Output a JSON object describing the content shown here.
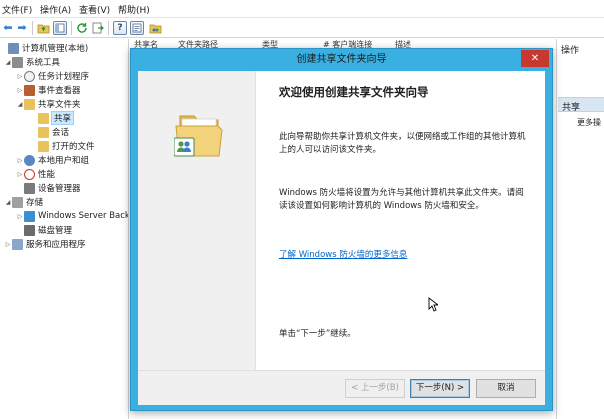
{
  "menubar": {
    "items": [
      "文件(F)",
      "操作(A)",
      "查看(V)",
      "帮助(H)"
    ]
  },
  "toolbar": {
    "icons": [
      "back-arrow-icon",
      "forward-arrow-icon",
      "up-folder-icon",
      "show-tree-icon",
      "refresh-icon",
      "export-list-icon",
      "help-icon",
      "properties-icon",
      "share-folder-icon"
    ]
  },
  "tree": {
    "root": "计算机管理(本地)",
    "system_tools": "系统工具",
    "task_scheduler": "任务计划程序",
    "event_viewer": "事件查看器",
    "shared_folders": "共享文件夹",
    "shares": "共享",
    "sessions": "会话",
    "open_files": "打开的文件",
    "local_users": "本地用户和组",
    "performance": "性能",
    "device_manager": "设备管理器",
    "storage": "存储",
    "windows_server_backup": "Windows Server Back",
    "disk_management": "磁盘管理",
    "services_apps": "服务和应用程序"
  },
  "list_header": {
    "columns": [
      "共享名",
      "文件夹路径",
      "类型",
      "# 客户端连接",
      "描述"
    ]
  },
  "actions": {
    "title": "操作",
    "section": "共享",
    "more": "更多操"
  },
  "wizard": {
    "title": "创建共享文件夹向导",
    "close": "✕",
    "welcome_title": "欢迎使用创建共享文件夹向导",
    "intro": "此向导帮助你共享计算机文件夹，以便网络或工作组的其他计算机上的人可以访问该文件夹。",
    "firewall": "Windows 防火墙将设置为允许与其他计算机共享此文件夹。请阅读该设置如何影响计算机的 Windows 防火墙和安全。",
    "link": "了解 Windows 防火墙的更多信息",
    "next_hint": "单击“下一步”继续。",
    "buttons": {
      "back": "< 上一步(B)",
      "next": "下一步(N) >",
      "cancel": "取消"
    }
  },
  "colors": {
    "dialog_frame": "#3ab0e2",
    "close_button": "#c7382f",
    "link": "#0066cc",
    "selection": "#cce8ff"
  }
}
